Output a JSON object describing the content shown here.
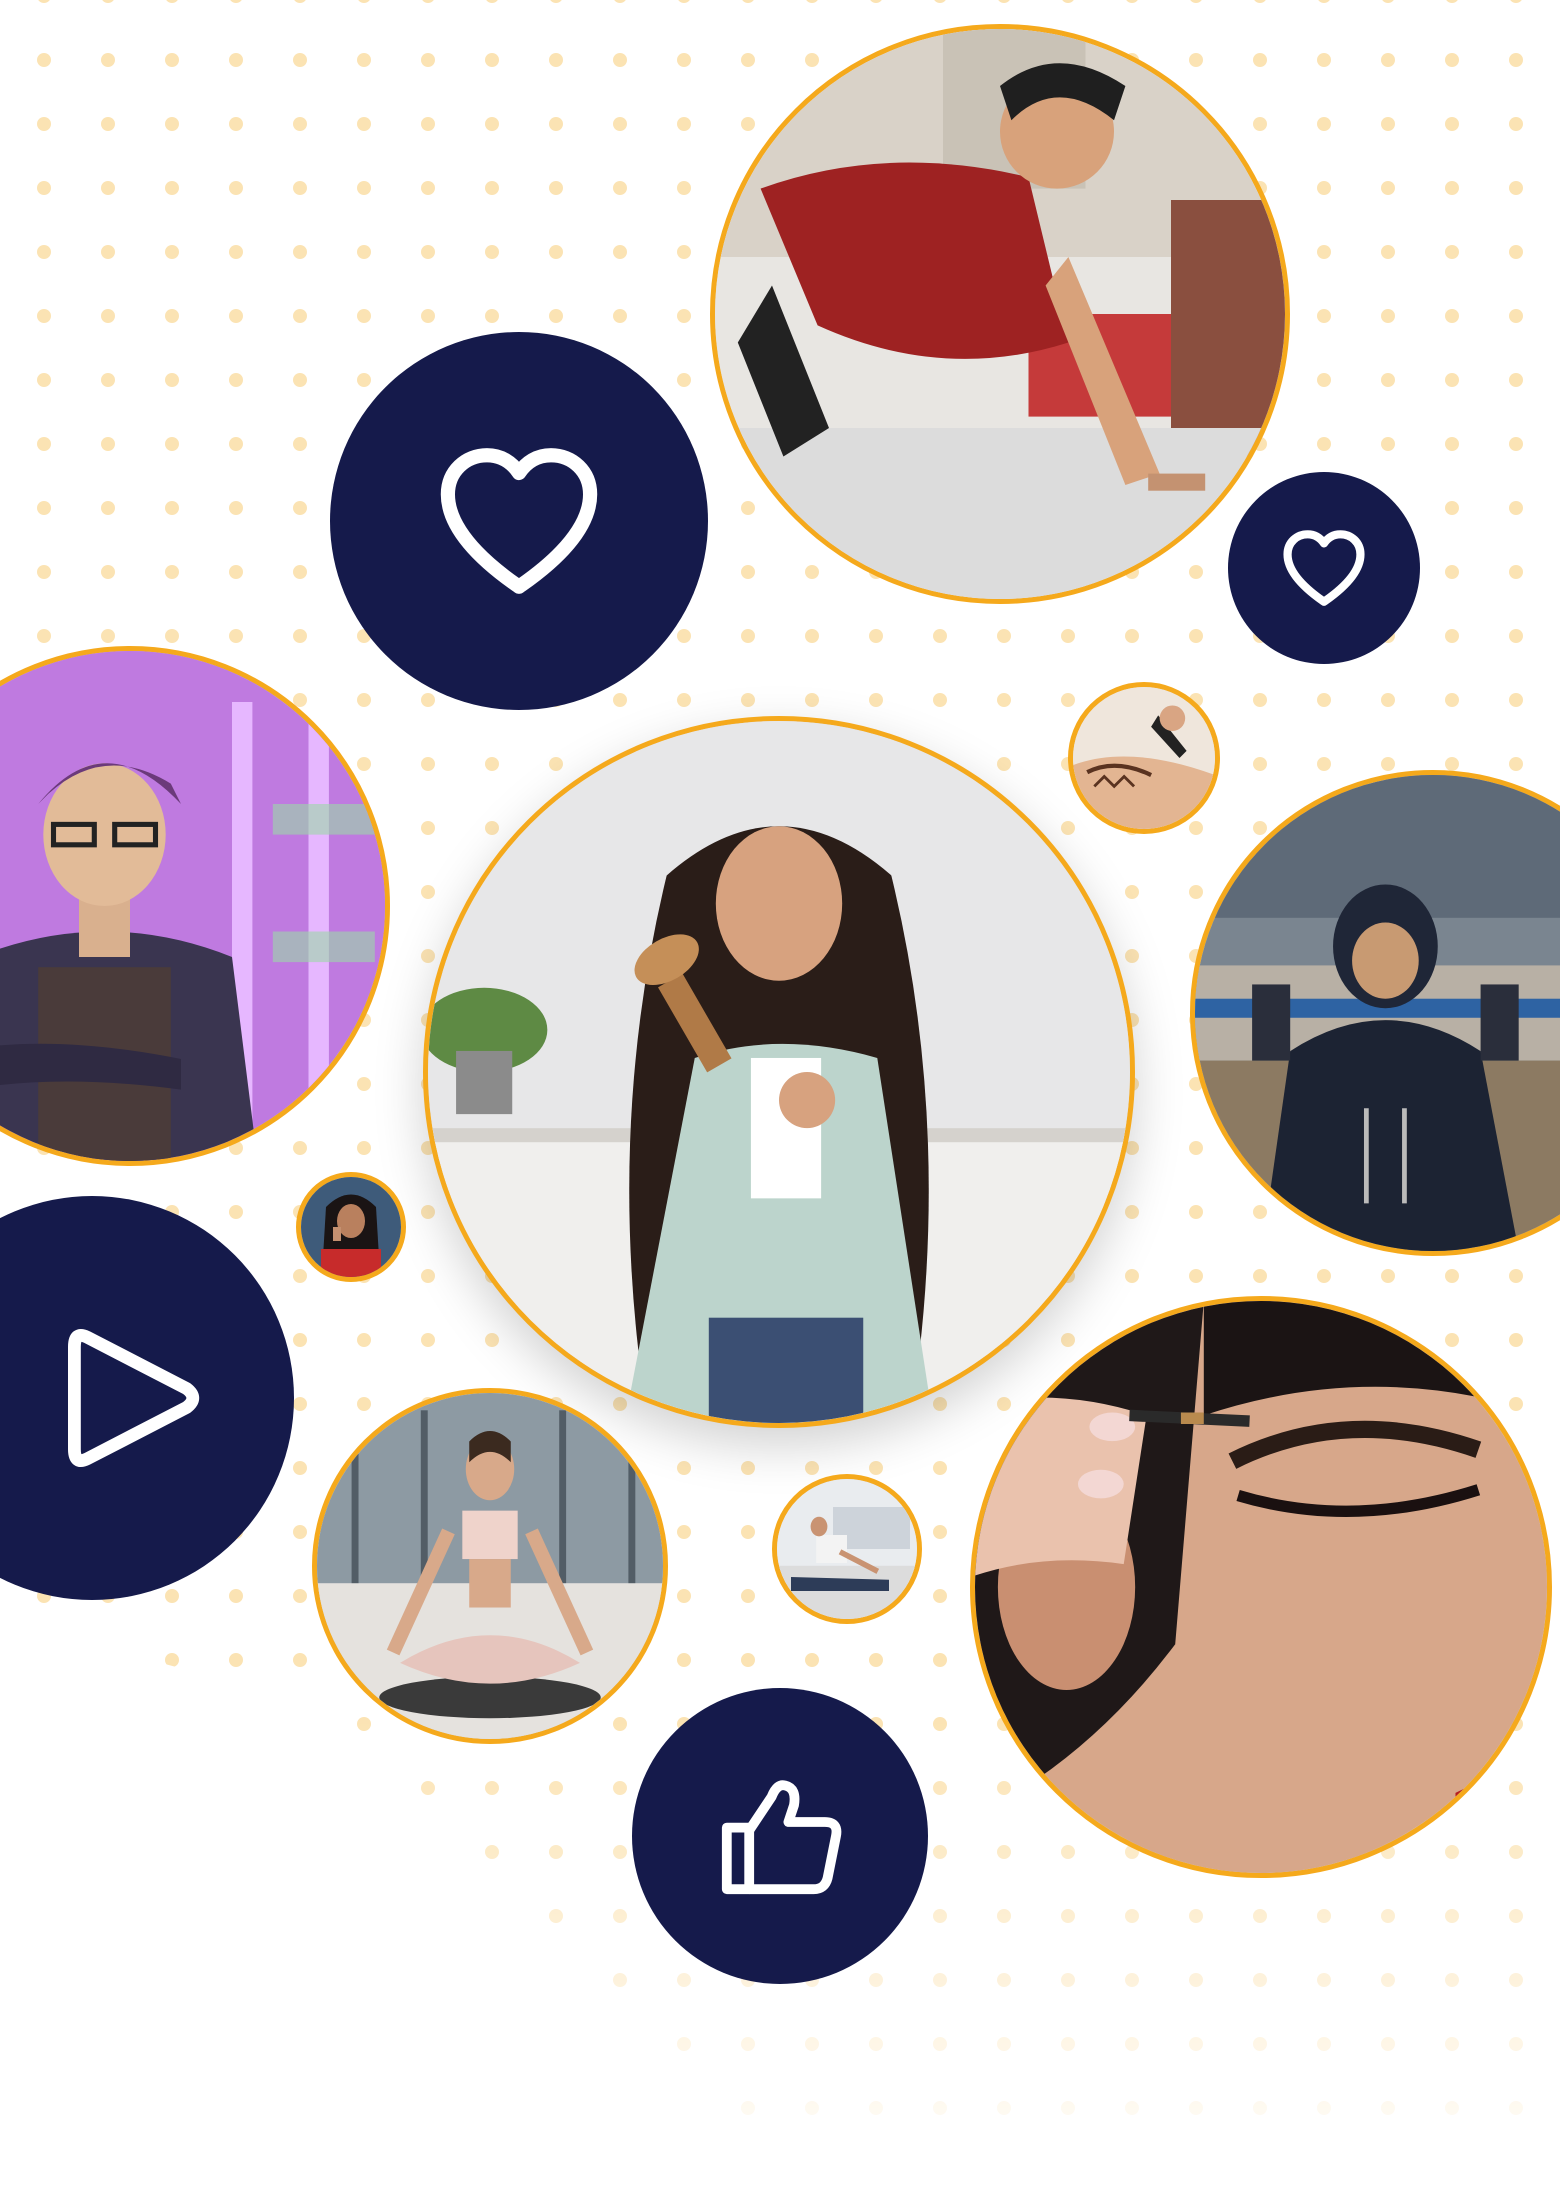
{
  "theme": {
    "accent_border": "#f5a91c",
    "badge_fill": "#151a4b",
    "icon_stroke": "#ffffff",
    "dot_color": "#fbe3b3"
  },
  "badges": [
    {
      "id": "heart-large",
      "icon": "heart-icon"
    },
    {
      "id": "heart-small",
      "icon": "heart-icon"
    },
    {
      "id": "play",
      "icon": "play-icon"
    },
    {
      "id": "thumbs-up",
      "icon": "thumbs-up-icon"
    }
  ],
  "photos": [
    {
      "id": "pushup",
      "subject": "man-doing-pushup"
    },
    {
      "id": "henna",
      "subject": "henna-hand"
    },
    {
      "id": "grower",
      "subject": "man-with-apron"
    },
    {
      "id": "hair-brushing",
      "subject": "woman-brushing-hair"
    },
    {
      "id": "pullup",
      "subject": "man-doing-pullup"
    },
    {
      "id": "phone-call",
      "subject": "woman-on-phone"
    },
    {
      "id": "yoga",
      "subject": "woman-meditating"
    },
    {
      "id": "stretch",
      "subject": "man-stretching"
    },
    {
      "id": "eyeliner",
      "subject": "eye-makeup"
    }
  ]
}
